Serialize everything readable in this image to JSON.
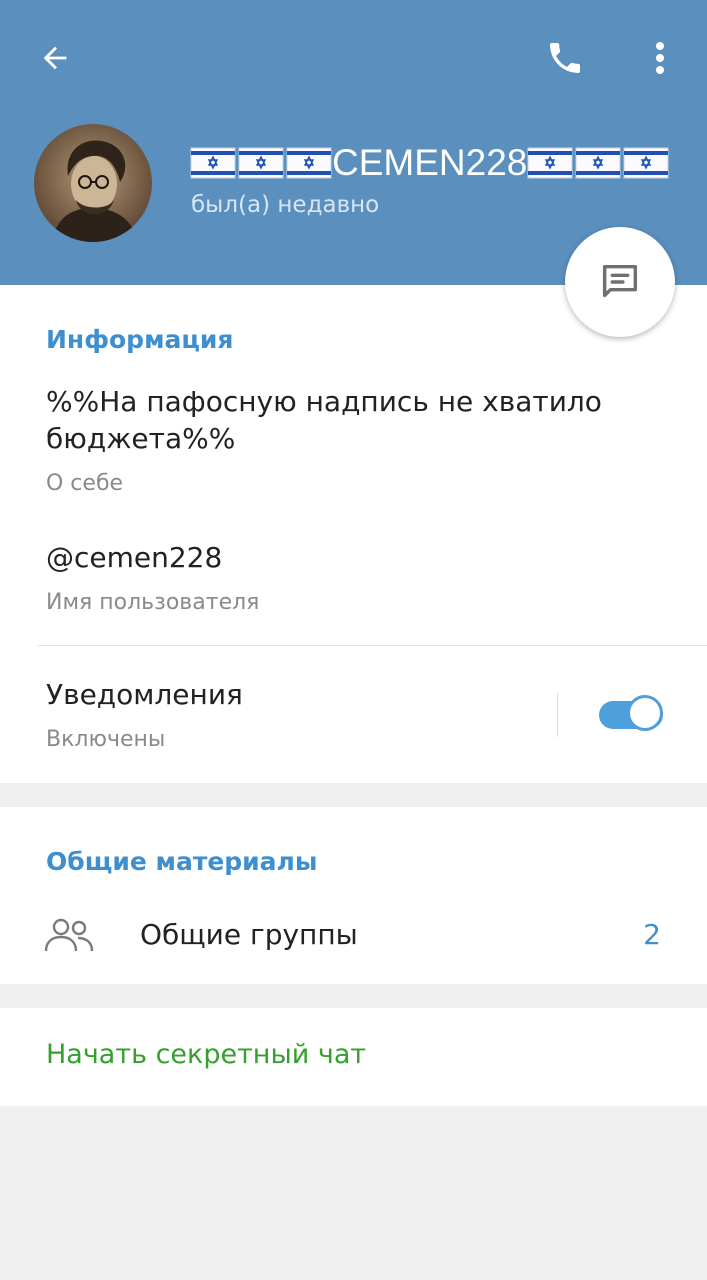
{
  "header": {
    "background_color": "#5b8fbe",
    "back_icon": "arrow-left-icon",
    "call_icon": "phone-icon",
    "more_icon": "more-vertical-icon"
  },
  "profile": {
    "name": "CEMEN228",
    "flag_icon": "israel-flag-icon",
    "flags_before": 3,
    "flags_after": 3,
    "status": "был(а) недавно",
    "avatar": "portrait-photo"
  },
  "fab": {
    "icon": "message-icon"
  },
  "info": {
    "title": "Информация",
    "bio": "%%На пафосную надпись не хватило бюджета%%",
    "bio_caption": "О себе",
    "username": "@cemen228",
    "username_caption": "Имя пользователя",
    "notifications_label": "Уведомления",
    "notifications_status": "Включены",
    "notifications_enabled": true
  },
  "shared": {
    "title": "Общие материалы",
    "groups_icon": "users-icon",
    "groups_label": "Общие группы",
    "groups_count": "2"
  },
  "secret_chat": {
    "label": "Начать секретный чат",
    "color": "#35a02e"
  },
  "accent_color": "#3d8fcf"
}
